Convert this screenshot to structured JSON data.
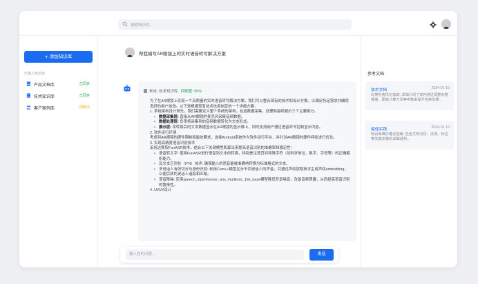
{
  "search": {
    "placeholder": "搜索知识库..."
  },
  "sidebar": {
    "add_button": "添加知识库",
    "section_title": "已接入知识库",
    "items": [
      {
        "label": "产品文档库",
        "badge": "已同步",
        "badge_color": "#19a24a",
        "icon_color": "#1a6cf0"
      },
      {
        "label": "技术知识库",
        "badge": "已同步",
        "badge_color": "#19a24a",
        "icon_color": "#1a6cf0"
      },
      {
        "label": "客户案例库",
        "badge": "同步中",
        "badge_color": "#e6a700",
        "icon_color": "#4a6cf0"
      }
    ]
  },
  "chat": {
    "question": "帮我编写AR眼镜上的实时语音转写解决方案",
    "source_label": "来自: 技术知识库",
    "match_label": "匹配度: 95%",
    "answer": {
      "intro": "为了在AR眼镜上实现一个高质量的实时语音转写解决方案，我们可以整合现有的技术和设计方案。以满足特定需求并确保良好的用户体验。以下是根据现有技术信息制定的一个详细方案：",
      "s1": "1. 系统架构设计首先，我们需要定义整个系统的架构，包括数据采集、处理和最终展示三个主要部分。",
      "b1_title": "数据采集层:",
      "b1_text": "直接从AR眼镜的麦克风采集音频数据。",
      "b2_title": "数据处理层:",
      "b2_text": "负责将采集到的音频数据转化为文本形式。",
      "b3_title": "展示层:",
      "b3_text": "将转换后的文本数据显示在AR眼镜的显示屏上，同时支持用户通过语音命令控制显示内容。",
      "s2": "2. 软件运行环境",
      "s2_text": "考虑到AR眼镜的硬件限制和能效要求，选择Android系统作为软件运行平台，并针对AR眼镜的硬件特性进行优化。",
      "s3": "3. 实现高精度语音识别技术",
      "s3_text": "采用达摩院FunASR技术，结合以下关键模型和算法来提高语音识别的准确率和稳定性：",
      "sub1": "语音转文字: 使用FunASR进行语音到文本的转换，特别是注意其对特殊字符（如科学单位、数字、字母等）的正确解析能力。",
      "sub2": "及文本正则化（ITN）技术: 确保输入的语音能被准确地转换为标准格式的文本。",
      "sub3": "多说话人有效切分与身份识别: 利用Cam++模型区分不同说话人的声音，并通过声纹提取技术生成声纹embedding，以便后续的说话人追踪和匹配。",
      "sub4": "语音降噪: 应用speech_zipenhancer_ans_multiloss_16k_base模型降低背景噪音，改善音频质量，从而提高语音识别的鲁棒性。",
      "s4": "4. UI/UX设计"
    },
    "input_placeholder": "输入您的问题...",
    "send_label": "发送"
  },
  "references": {
    "title": "参考文档",
    "items": [
      {
        "title": "技术文档",
        "date": "2024-01-15",
        "text": "向量检索优化指南: 详细介绍了如何通过调整向量维度、距离计算方法等参数来提升检索效果..."
      },
      {
        "title": "最佳实践",
        "date": "2024-01-10",
        "text": "知识库维护建议指南: 包含文档分段、清洗、标注等关键步骤的详细说明..."
      }
    ]
  },
  "colors": {
    "accent": "#1a6cf0",
    "success": "#19a24a",
    "warning": "#e6a700"
  }
}
